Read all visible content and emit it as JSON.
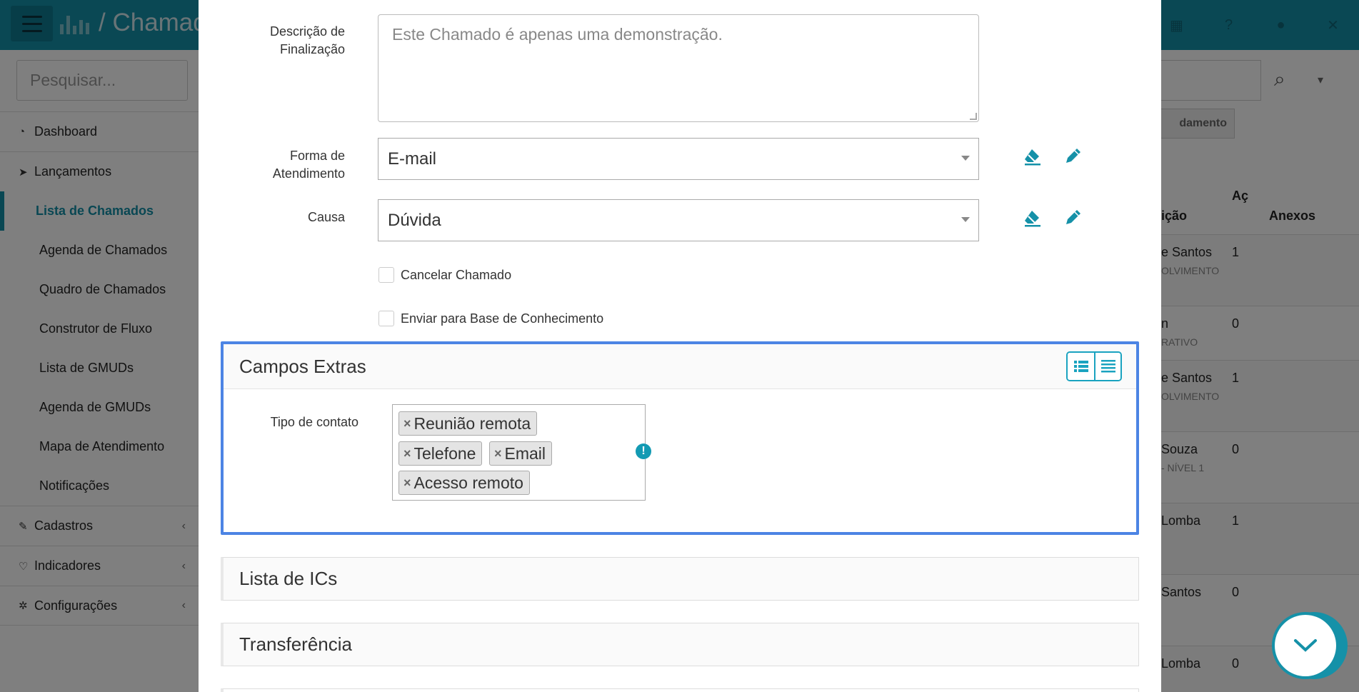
{
  "app": {
    "title": "/   Chamados"
  },
  "sidebar": {
    "search_placeholder": "Pesquisar...",
    "dashboard": "Dashboard",
    "lancamentos": "Lançamentos",
    "sub_items": [
      "Lista de Chamados",
      "Agenda de Chamados",
      "Quadro de Chamados",
      "Construtor de Fluxo",
      "Lista de GMUDs",
      "Agenda de GMUDs",
      "Mapa de Atendimento",
      "Notificações"
    ],
    "cadastros": "Cadastros",
    "indicadores": "Indicadores",
    "configuracoes": "Configurações"
  },
  "background_table": {
    "button_label": "damento",
    "headers": {
      "col1": "ição",
      "col2": "Aç",
      "col3": "Anexos"
    },
    "rows": [
      {
        "name": "e Santos",
        "sub": "OLVIMENTO",
        "count": "1"
      },
      {
        "name": "n",
        "sub": "RATIVO",
        "count": "0"
      },
      {
        "name": "e Santos",
        "sub": "OLVIMENTO",
        "count": "1"
      },
      {
        "name": "Souza",
        "sub": "- NÍVEL 1",
        "count": "0"
      },
      {
        "name": "Lomba",
        "sub": "",
        "count": "1"
      },
      {
        "name": "Santos",
        "sub": "",
        "count": "0"
      },
      {
        "name": "Lomba",
        "sub": "",
        "count": "0"
      }
    ]
  },
  "form": {
    "descricao_label_1": "Descrição de",
    "descricao_label_2": "Finalização",
    "descricao_value": "Este Chamado é apenas uma demonstração.",
    "forma_label_1": "Forma de",
    "forma_label_2": "Atendimento",
    "forma_value": "E-mail",
    "causa_label": "Causa",
    "causa_value": "Dúvida",
    "cancelar_label": "Cancelar Chamado",
    "enviar_label": "Enviar para Base de Conhecimento"
  },
  "extras": {
    "title": "Campos Extras",
    "tipo_label": "Tipo de contato",
    "tags": [
      "Reunião remota",
      "Telefone",
      "Email",
      "Acesso remoto"
    ],
    "tag_remove": "×",
    "alert_symbol": "!"
  },
  "panels": {
    "lista_ics": "Lista de ICs",
    "transferencia": "Transferência"
  },
  "colors": {
    "accent": "#1591a8",
    "focus_border": "#4c84e4"
  }
}
